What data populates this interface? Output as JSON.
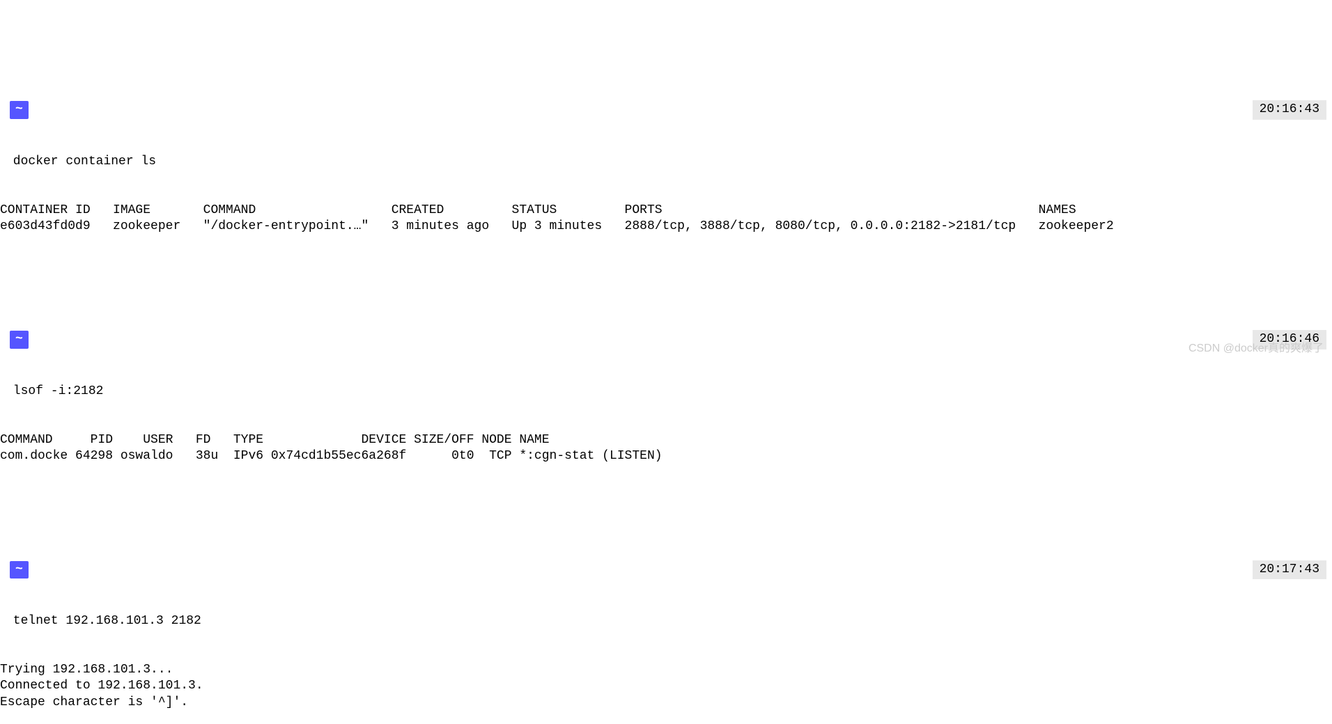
{
  "blocks": [
    {
      "timestamp": "20:16:43",
      "tilde": "~",
      "command": " docker container ls",
      "output": "CONTAINER ID   IMAGE       COMMAND                  CREATED         STATUS         PORTS                                                  NAMES\ne603d43fd0d9   zookeeper   \"/docker-entrypoint.…\"   3 minutes ago   Up 3 minutes   2888/tcp, 3888/tcp, 8080/tcp, 0.0.0.0:2182->2181/tcp   zookeeper2"
    },
    {
      "timestamp": "20:16:46",
      "tilde": "~",
      "command": " lsof -i:2182",
      "output": "COMMAND     PID    USER   FD   TYPE             DEVICE SIZE/OFF NODE NAME\ncom.docke 64298 oswaldo   38u  IPv6 0x74cd1b55ec6a268f      0t0  TCP *:cgn-stat (LISTEN)"
    },
    {
      "timestamp": "20:17:43",
      "tilde": "~",
      "command": " telnet 192.168.101.3 2182",
      "output": "Trying 192.168.101.3...\nConnected to 192.168.101.3.\nEscape character is '^]'."
    }
  ],
  "watermark": "CSDN @docker真的爽爆了"
}
